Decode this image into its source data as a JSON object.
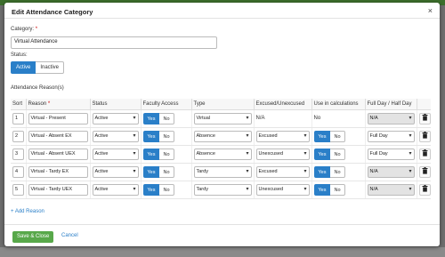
{
  "modal": {
    "title": "Edit Attendance Category",
    "close_glyph": "×",
    "category_label": "Category:",
    "required_mark": "*",
    "category_value": "Virtual Attendance",
    "status_label": "Status:",
    "status_active": "Active",
    "status_inactive": "Inactive",
    "reasons_label": "Attendance Reason(s)",
    "columns": [
      "Sort",
      "Reason",
      "Status",
      "Faculty Access",
      "Type",
      "Excused/Unexcused",
      "Use in calculations",
      "Full Day / Half Day",
      ""
    ],
    "rows": [
      {
        "sort": "1",
        "reason": "Virtual - Present",
        "status": "Active",
        "faculty_access": "Yes",
        "type": "Virtual",
        "excused": "N/A",
        "excused_is_select": false,
        "calc": "No",
        "calc_is_toggle": false,
        "day": "N/A",
        "day_disabled": true
      },
      {
        "sort": "2",
        "reason": "Virtual - Absent EX",
        "status": "Active",
        "faculty_access": "Yes",
        "type": "Absence",
        "excused": "Excused",
        "excused_is_select": true,
        "calc": "Yes",
        "calc_is_toggle": true,
        "day": "Full Day",
        "day_disabled": false
      },
      {
        "sort": "3",
        "reason": "Virtual - Absent UEX",
        "status": "Active",
        "faculty_access": "Yes",
        "type": "Absence",
        "excused": "Unexcused",
        "excused_is_select": true,
        "calc": "Yes",
        "calc_is_toggle": true,
        "day": "Full Day",
        "day_disabled": false
      },
      {
        "sort": "4",
        "reason": "Virtual - Tardy EX",
        "status": "Active",
        "faculty_access": "Yes",
        "type": "Tardy",
        "excused": "Excused",
        "excused_is_select": true,
        "calc": "Yes",
        "calc_is_toggle": true,
        "day": "N/A",
        "day_disabled": true
      },
      {
        "sort": "5",
        "reason": "Virtual - Tardy UEX",
        "status": "Active",
        "faculty_access": "Yes",
        "type": "Tardy",
        "excused": "Unexcused",
        "excused_is_select": true,
        "calc": "Yes",
        "calc_is_toggle": true,
        "day": "N/A",
        "day_disabled": true
      }
    ],
    "yes_label": "Yes",
    "no_label": "No",
    "add_reason": "+ Add Reason",
    "save_close": "Save & Close",
    "cancel": "Cancel"
  },
  "colors": {
    "primary": "#2a7fc8",
    "save": "#58a84a",
    "topbar": "#3c6e2c"
  }
}
